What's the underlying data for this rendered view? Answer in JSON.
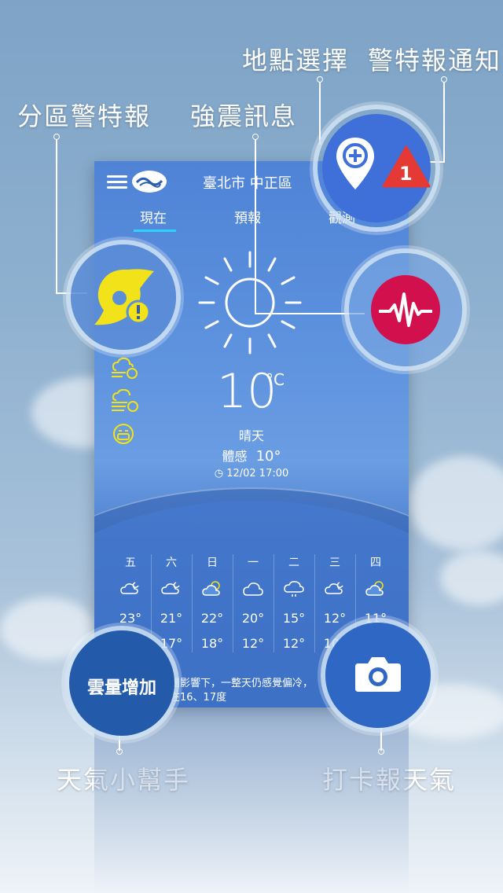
{
  "labels": {
    "location_select": "地點選擇",
    "warning_notify": "警特報通知",
    "district_warning": "分區警特報",
    "earthquake": "強震訊息",
    "weather_helper": "天氣小幫手",
    "checkin_weather": "打卡報天氣"
  },
  "app": {
    "city": "臺北市 中正區",
    "tabs": [
      "現在",
      "預報",
      "觀測"
    ],
    "current": {
      "temperature": "10",
      "unit": "°C",
      "condition": "晴天",
      "feels_like": "體感",
      "feels_like_value": "10°",
      "updated": "12/02 17:00"
    },
    "warning_badge_count": "1",
    "weekly": [
      {
        "day": "五",
        "icon": "partly-cloudy-night-icon",
        "hi": "23°",
        "lo": ""
      },
      {
        "day": "六",
        "icon": "partly-cloudy-night-icon",
        "hi": "21°",
        "lo": "17°"
      },
      {
        "day": "日",
        "icon": "partly-sunny-icon",
        "hi": "22°",
        "lo": "18°"
      },
      {
        "day": "一",
        "icon": "cloudy-icon",
        "hi": "20°",
        "lo": "12°"
      },
      {
        "day": "二",
        "icon": "rain-cloud-icon",
        "hi": "15°",
        "lo": "12°"
      },
      {
        "day": "三",
        "icon": "partly-cloudy-night-icon",
        "hi": "12°",
        "lo": "10°"
      },
      {
        "day": "四",
        "icon": "partly-sunny-icon",
        "hi": "11°",
        "lo": ""
      }
    ],
    "helper_note_line1": "團影響下，一整天仍感覺偏冷，",
    "helper_note_line2": "在16、17度",
    "helper_bubble": "雲量增加"
  },
  "colors": {
    "accent": "#2fd0ff",
    "typhoon": "#f1e21a",
    "earthquake": "#d3104e",
    "warning_red": "#e53935",
    "button_blue": "#3f6fd8"
  }
}
